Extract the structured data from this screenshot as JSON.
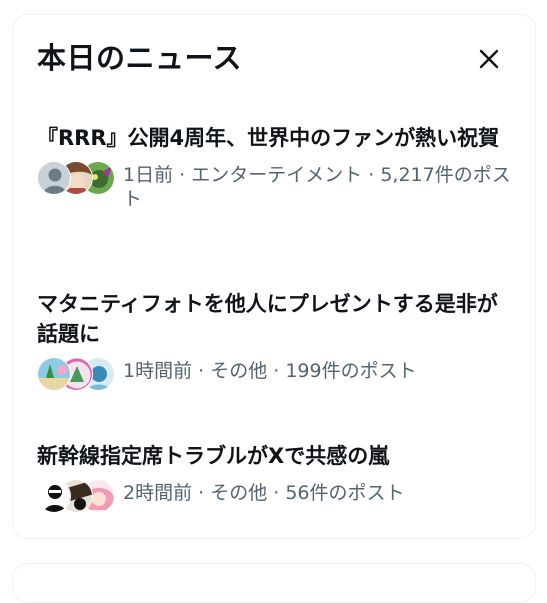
{
  "header": {
    "title": "本日のニュース",
    "close_icon": "close-icon"
  },
  "news": [
    {
      "title": "『RRR』公開4周年、世界中のファンが熱い祝賀",
      "meta": "1日前 · エンターテイメント · 5,217件のポスト",
      "avatars": [
        "default-user-avatar",
        "anime-avatar",
        "green-anime-avatar"
      ]
    },
    {
      "title": "マタニティフォトを他人にプレゼントする是非が話題に",
      "meta": "1時間前 · その他 · 199件のポスト",
      "avatars": [
        "beach-avatar",
        "pink-frame-avatar",
        "blue-avatar"
      ]
    },
    {
      "title": "新幹線指定席トラブルがXで共感の嵐",
      "meta": "2時間前 · その他 · 56件のポスト",
      "avatars": [
        "black-white-avatar",
        "dark-avatar",
        "pink-hair-avatar"
      ]
    }
  ],
  "colors": {
    "text": "#0f1419",
    "secondary": "#536471",
    "border": "#eff3f4"
  }
}
